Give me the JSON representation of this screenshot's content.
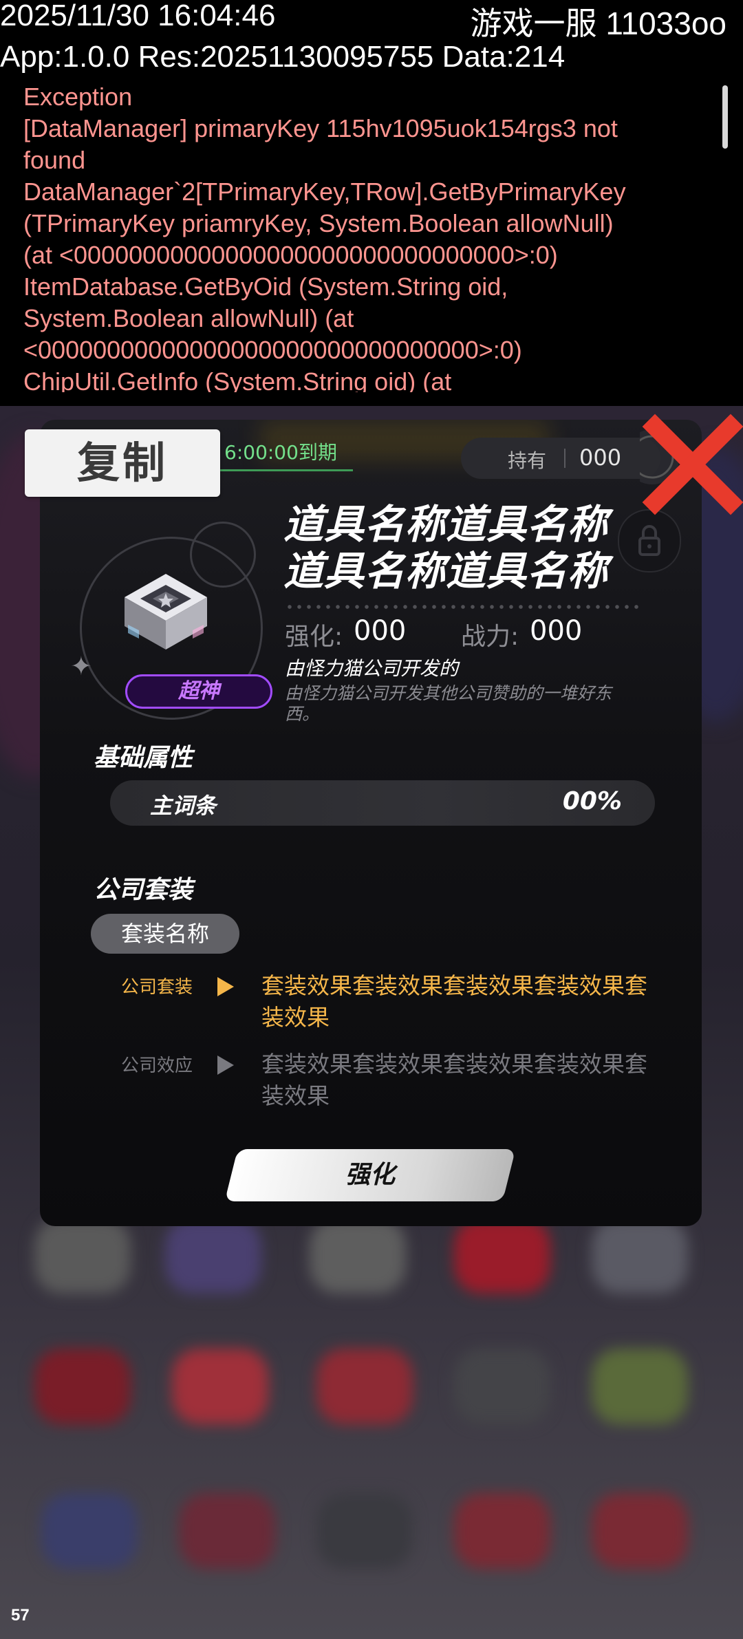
{
  "debug": {
    "timestamp": "2025/11/30 16:04:46",
    "server": "游戏一服 11033oo",
    "version_line": "App:1.0.0 Res:20251130095755 Data:214",
    "exception_lines": [
      "Exception",
      "[DataManager] primaryKey 115hv1095uok154rgs3 not",
      "found",
      "DataManager`2[TPrimaryKey,TRow].GetByPrimaryKey",
      "(TPrimaryKey priamryKey, System.Boolean allowNull)",
      "(at <00000000000000000000000000000000>:0)",
      "ItemDatabase.GetByOid (System.String oid,",
      "System.Boolean allowNull) (at",
      "<00000000000000000000000000000000>:0)",
      "ChipUtil.GetInfo (System.String oid) (at"
    ]
  },
  "copy_button": {
    "label": "复制"
  },
  "item": {
    "expire": "6:00:00到期",
    "hold_label": "持有",
    "hold_value": "000",
    "name": "道具名称道具名称道具名称道具名称",
    "rarity": "超神",
    "enhance_label": "强化:",
    "enhance_value": "000",
    "power_label": "战力:",
    "power_value": "000",
    "developer": "由怪力猫公司开发的",
    "description": "由怪力猫公司开发其他公司赞助的一堆好东西。"
  },
  "base_attr": {
    "title": "基础属性",
    "name": "主词条",
    "value": "00%"
  },
  "suit": {
    "title": "公司套装",
    "name": "套装名称",
    "effects": [
      {
        "label": "公司套装",
        "text": "套装效果套装效果套装效果套装效果套装效果"
      },
      {
        "label": "公司效应",
        "text": "套装效果套装效果套装效果套装效果套装效果"
      }
    ]
  },
  "upgrade_button": {
    "label": "强化"
  },
  "fps": "57",
  "colors": {
    "rarity": "#a24cff",
    "active_effect": "#f5b64a",
    "inactive_effect": "#7a7a80",
    "expire": "#73e08b",
    "close": "#e83a2c",
    "log": "#ff9590"
  }
}
